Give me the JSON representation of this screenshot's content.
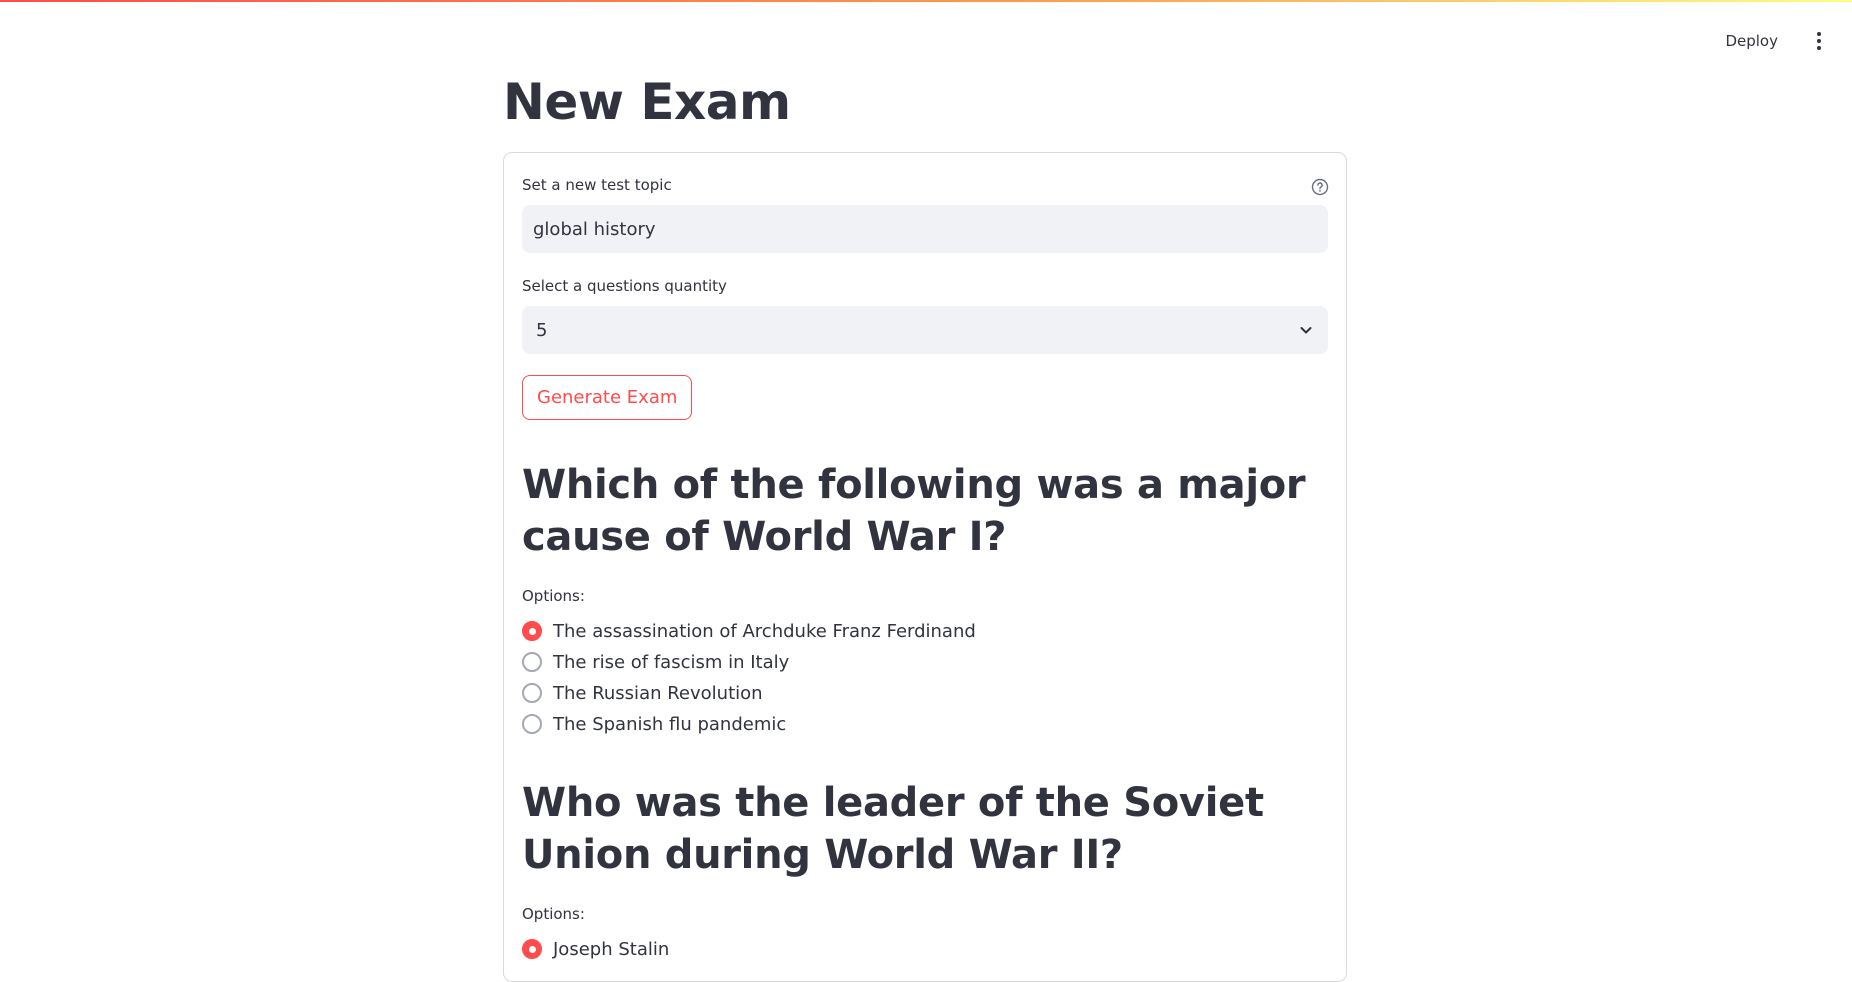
{
  "header": {
    "deploy_label": "Deploy",
    "menu_icon": "vertical-ellipsis-icon"
  },
  "page": {
    "title": "New Exam"
  },
  "form": {
    "topic_label": "Set a new test topic",
    "topic_value": "global history",
    "help_icon": "question-circle-icon",
    "quantity_label": "Select a questions quantity",
    "quantity_value": "5",
    "generate_label": "Generate Exam"
  },
  "questions": [
    {
      "text": "Which of the following was a major cause of World War I?",
      "options_label": "Options:",
      "options": [
        "The assassination of Archduke Franz Ferdinand",
        "The rise of fascism in Italy",
        "The Russian Revolution",
        "The Spanish flu pandemic"
      ],
      "selected_index": 0
    },
    {
      "text": "Who was the leader of the Soviet Union during World War II?",
      "options_label": "Options:",
      "options": [
        "Joseph Stalin"
      ],
      "selected_index": 0
    }
  ],
  "colors": {
    "accent": "#ff4b4b",
    "text": "#31333f",
    "input_bg": "#f0f2f6",
    "border": "#d9dadc"
  }
}
